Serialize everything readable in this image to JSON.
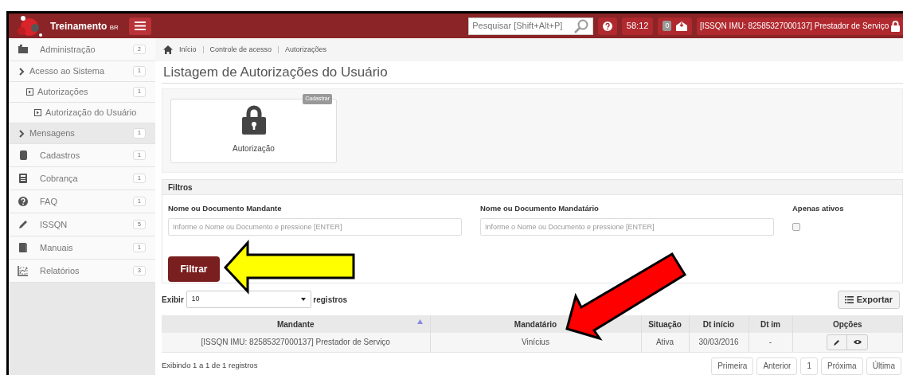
{
  "app": {
    "title": "Treinamento",
    "suffix": "BR"
  },
  "search": {
    "placeholder": "Pesquisar [Shift+Alt+P]"
  },
  "timer": "58:12",
  "message_count": "0",
  "user": "[ISSQN IMU: 82585327000137] Prestador de Serviço",
  "sidebar": {
    "items": [
      {
        "label": "Administração",
        "count": "2",
        "selected": false,
        "children": [
          {
            "label": "Acesso ao Sistema",
            "count": "1",
            "selected": false,
            "children": [
              {
                "label": "Autorizações",
                "count": "1",
                "selected": false,
                "children": [
                  {
                    "label": "Autorização do Usuário",
                    "selected": false
                  }
                ]
              }
            ]
          },
          {
            "label": "Mensagens",
            "count": "1",
            "selected": true
          }
        ]
      },
      {
        "label": "Cadastros",
        "count": "1",
        "selected": false
      },
      {
        "label": "Cobrança",
        "count": "1",
        "selected": false
      },
      {
        "label": "FAQ",
        "count": "1",
        "selected": false
      },
      {
        "label": "ISSQN",
        "count": "5",
        "selected": false
      },
      {
        "label": "Manuais",
        "count": "1",
        "selected": false
      },
      {
        "label": "Relatórios",
        "count": "3",
        "selected": false
      }
    ]
  },
  "breadcrumb": [
    "Início",
    "Controle de acesso",
    "Autorizações"
  ],
  "page_title": "Listagem de Autorizações do Usuário",
  "tiles": [
    {
      "label": "Autorização",
      "badge": "Cadastrar"
    }
  ],
  "filters": {
    "title": "Filtros",
    "fields": [
      {
        "kind": "text",
        "label": "Nome ou Documento Mandante",
        "placeholder": "Informe o Nome ou Documento e pressione [ENTER]"
      },
      {
        "kind": "text",
        "label": "Nome ou Documento Mandatário",
        "placeholder": "Informe o Nome ou Documento e pressione [ENTER]"
      },
      {
        "kind": "checkbox",
        "label": "Apenas ativos",
        "checked": false
      }
    ],
    "button": "Filtrar"
  },
  "table": {
    "length_prefix": "Exibir",
    "length_value": "10",
    "length_suffix": "registros",
    "export": "Exportar",
    "columns": [
      {
        "label": "Mandante",
        "sorted": true
      },
      {
        "label": "Mandatário",
        "sorted": false
      },
      {
        "label": "Situação",
        "sorted": false
      },
      {
        "label": "Dt início",
        "sorted": false
      },
      {
        "label": "Dt im",
        "sorted": false
      },
      {
        "label": "Opções",
        "sorted": false
      }
    ],
    "rows": [
      [
        "[ISSQN IMU: 82585327000137] Prestador de Serviço",
        "Vinícius",
        "Ativa",
        "30/03/2016",
        "-"
      ]
    ],
    "info": "Exibindo 1 a 1 de 1 registros",
    "pagination": [
      "Primeira",
      "Anterior",
      "1",
      "Próxima",
      "Última"
    ]
  }
}
